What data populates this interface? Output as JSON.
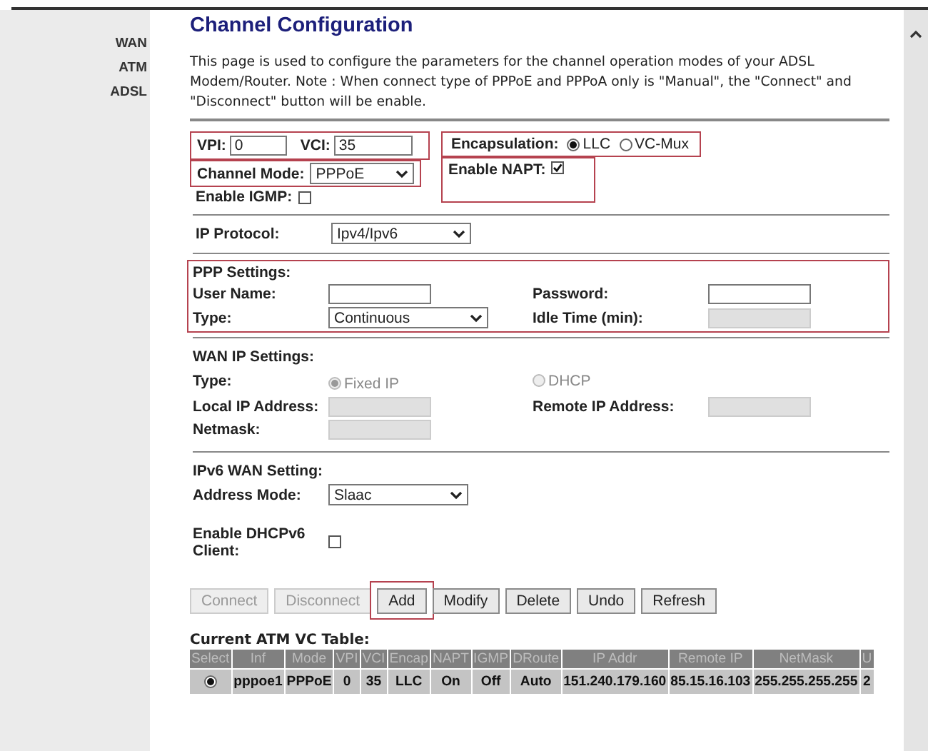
{
  "sidebar": {
    "items": [
      {
        "label": "WAN"
      },
      {
        "label": "ATM"
      },
      {
        "label": "ADSL"
      }
    ]
  },
  "title": "Channel Configuration",
  "description": "This page is used to configure the parameters for the channel operation modes of your ADSL Modem/Router. Note : When connect type of PPPoE and PPPoA only is \"Manual\", the \"Connect\" and \"Disconnect\" button will be enable.",
  "vpi_vci": {
    "highlighted": true,
    "vpi": {
      "label": "VPI:",
      "value": "0"
    },
    "vci": {
      "label": "VCI:",
      "value": "35"
    }
  },
  "encapsulation": {
    "highlighted": true,
    "label": "Encapsulation:",
    "options": [
      {
        "label": "LLC",
        "selected": true
      },
      {
        "label": "VC-Mux",
        "selected": false
      }
    ]
  },
  "channel_mode": {
    "highlighted": true,
    "label": "Channel Mode:",
    "value": "PPPoE"
  },
  "enable_napt": {
    "highlighted": true,
    "label": "Enable NAPT:",
    "checked": true
  },
  "enable_igmp": {
    "label": "Enable IGMP:",
    "checked": false
  },
  "ip_protocol": {
    "label": "IP Protocol:",
    "value": "Ipv4/Ipv6"
  },
  "ppp_settings": {
    "highlighted": true,
    "heading": "PPP Settings:",
    "fields": [
      {
        "label": "User Name:",
        "kind": "text",
        "disabled": false
      },
      {
        "label": "Password:",
        "kind": "text",
        "disabled": false
      },
      {
        "label": "Type:",
        "kind": "select",
        "value": "Continuous"
      },
      {
        "label": "Idle Time (min):",
        "kind": "text",
        "disabled": true
      }
    ]
  },
  "wan_ip_settings": {
    "heading": "WAN IP Settings:",
    "fields": [
      {
        "label": "Type:",
        "kind": "radio",
        "options": [
          {
            "label": "Fixed IP",
            "selected": true,
            "disabled": true
          },
          {
            "label": "DHCP",
            "selected": false,
            "disabled": true
          }
        ]
      },
      {
        "label": "Local IP Address:",
        "kind": "text",
        "disabled": true
      },
      {
        "label": "Remote IP Address:",
        "kind": "text",
        "disabled": true
      },
      {
        "label": "Netmask:",
        "kind": "text",
        "disabled": true
      }
    ]
  },
  "ipv6_wan_setting": {
    "heading": "IPv6 WAN Setting:",
    "address_mode": {
      "label": "Address Mode:",
      "value": "Slaac"
    },
    "enable_dhcpv6_client": {
      "label": "Enable DHCPv6 Client:",
      "checked": false
    }
  },
  "buttons": [
    {
      "label": "Connect",
      "disabled": true
    },
    {
      "label": "Disconnect",
      "disabled": true
    },
    {
      "label": "Add",
      "disabled": false,
      "highlighted": true
    },
    {
      "label": "Modify",
      "disabled": false
    },
    {
      "label": "Delete",
      "disabled": false
    },
    {
      "label": "Undo",
      "disabled": false
    },
    {
      "label": "Refresh",
      "disabled": false
    }
  ],
  "vc_table": {
    "title": "Current ATM VC Table:",
    "columns": [
      "Select",
      "Inf",
      "Mode",
      "VPI",
      "VCI",
      "Encap",
      "NAPT",
      "IGMP",
      "DRoute",
      "IP Addr",
      "Remote IP",
      "NetMask",
      "U"
    ],
    "rows": [
      {
        "selected": true,
        "cells": [
          "",
          "pppoe1",
          "PPPoE",
          "0",
          "35",
          "LLC",
          "On",
          "Off",
          "Auto",
          "151.240.179.160",
          "85.15.16.103",
          "255.255.255.255",
          "2"
        ]
      }
    ]
  }
}
